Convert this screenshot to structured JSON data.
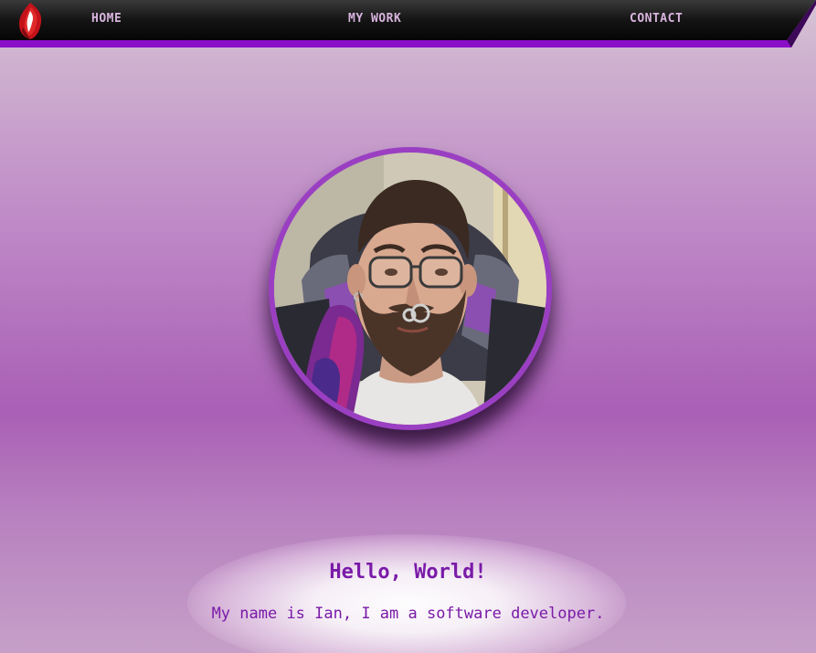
{
  "nav": {
    "logo": "flame-logo-icon",
    "items": [
      {
        "label": "HOME"
      },
      {
        "label": "MY WORK"
      },
      {
        "label": "CONTACT"
      }
    ]
  },
  "profile": {
    "image": "profile-photo"
  },
  "intro": {
    "headline": "Hello, World!",
    "text": "My name is Ian, I am a software developer."
  },
  "colors": {
    "accent": "#8a0fc8",
    "nav_text": "#d8b4de",
    "heading_text": "#7a1aa8",
    "nav_bg": "#111111"
  }
}
